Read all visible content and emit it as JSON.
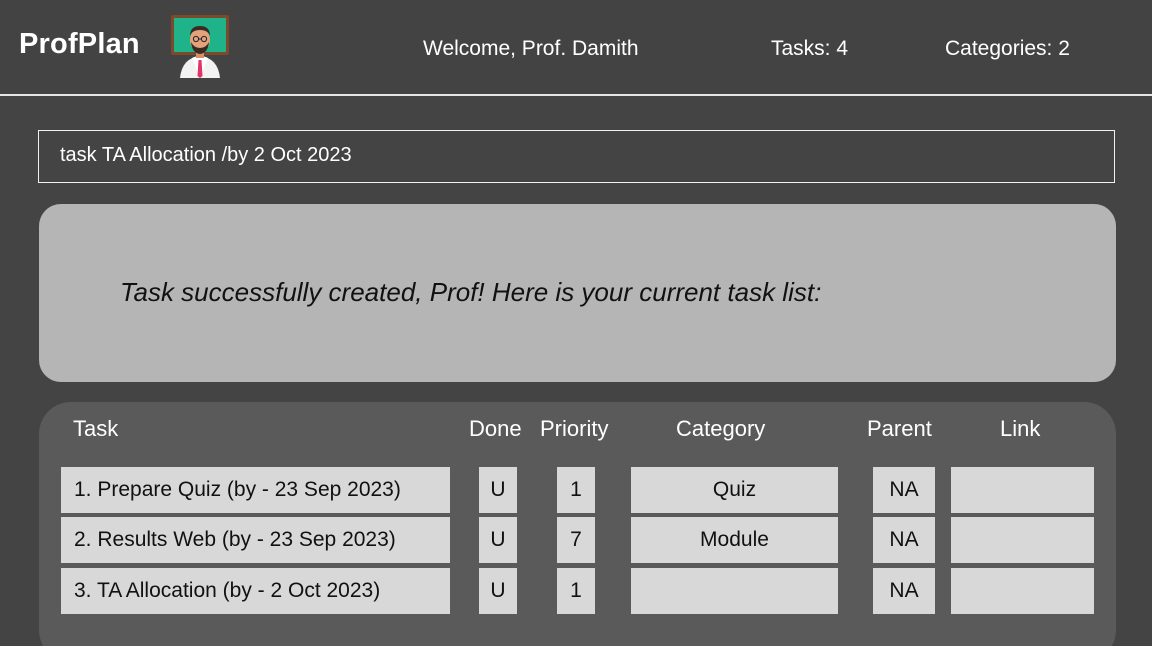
{
  "header": {
    "app_title": "ProfPlan",
    "welcome": "Welcome, Prof. Damith",
    "tasks_count": "Tasks: 4",
    "categories_count": "Categories: 2",
    "logo_icon": "professor-at-chalkboard-icon"
  },
  "command": {
    "value": "task TA Allocation /by 2 Oct 2023"
  },
  "result": {
    "message": "Task successfully created, Prof! Here is your current task list:"
  },
  "task_list": {
    "columns": {
      "task": "Task",
      "done": "Done",
      "priority": "Priority",
      "category": "Category",
      "parent": "Parent",
      "link": "Link"
    },
    "rows": [
      {
        "task": "1. Prepare Quiz (by - 23 Sep 2023)",
        "done": "U",
        "priority": "1",
        "category": "Quiz",
        "parent": "NA",
        "link": ""
      },
      {
        "task": "2. Results Web (by - 23 Sep 2023)",
        "done": "U",
        "priority": "7",
        "category": "Module",
        "parent": "NA",
        "link": ""
      },
      {
        "task": "3. TA Allocation (by - 2 Oct 2023)",
        "done": "U",
        "priority": "1",
        "category": "",
        "parent": "NA",
        "link": ""
      }
    ]
  },
  "colors": {
    "background": "#444444",
    "result_box": "#b5b5b5",
    "list_panel": "#5a5a5a",
    "cell": "#d8d8d8",
    "header_divider": "#e6e6e6"
  }
}
